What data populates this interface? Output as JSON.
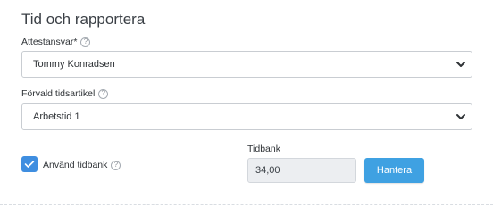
{
  "section": {
    "title": "Tid och rapportera"
  },
  "attest": {
    "label": "Attestansvar*",
    "help_icon": "question-circle-icon",
    "value": "Tommy Konradsen"
  },
  "article": {
    "label": "Förvald tidsartikel",
    "help_icon": "question-circle-icon",
    "value": "Arbetstid 1"
  },
  "timebank_toggle": {
    "label": "Använd tidbank",
    "checked": true,
    "help_icon": "question-circle-icon"
  },
  "timebank": {
    "label": "Tidbank",
    "value": "34,00",
    "button_label": "Hantera"
  },
  "colors": {
    "accent": "#3f8ee0",
    "button": "#3fa1e2"
  }
}
